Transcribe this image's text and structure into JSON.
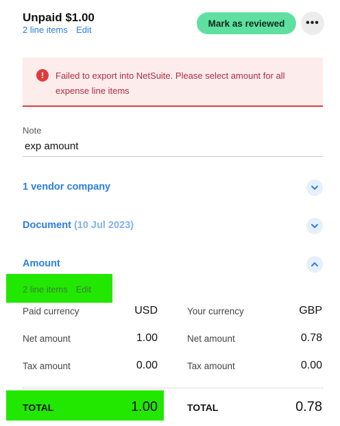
{
  "header": {
    "title": "Unpaid $1.00",
    "line_items": "2 line items",
    "edit_label": "Edit",
    "review_button": "Mark as reviewed",
    "more_button": "•••"
  },
  "alert": {
    "icon": "!",
    "message": "Failed to export into NetSuite. Please select amount for all expense line items",
    "color": "#e03b3b"
  },
  "note": {
    "label": "Note",
    "value": "exp amount"
  },
  "sections": {
    "vendor": {
      "title": "1 vendor company"
    },
    "document": {
      "title": "Document",
      "date": "(10 Jul 2023)"
    },
    "amount": {
      "title": "Amount"
    }
  },
  "amount": {
    "line_items": "2 line items",
    "edit_label": "Edit",
    "paid": {
      "currency_label": "Paid currency",
      "currency": "USD",
      "net_label": "Net amount",
      "net": "1.00",
      "tax_label": "Tax amount",
      "tax": "0.00",
      "total_label": "TOTAL",
      "total": "1.00"
    },
    "yours": {
      "currency_label": "Your currency",
      "currency": "GBP",
      "net_label": "Net amount",
      "net": "0.78",
      "tax_label": "Tax amount",
      "tax": "0.00",
      "total_label": "TOTAL",
      "total": "0.78"
    }
  },
  "colors": {
    "accent": "#2a7de1",
    "review_button": "#5fe0a0",
    "highlight": "#22e800",
    "alert_bg": "#fdecec"
  }
}
